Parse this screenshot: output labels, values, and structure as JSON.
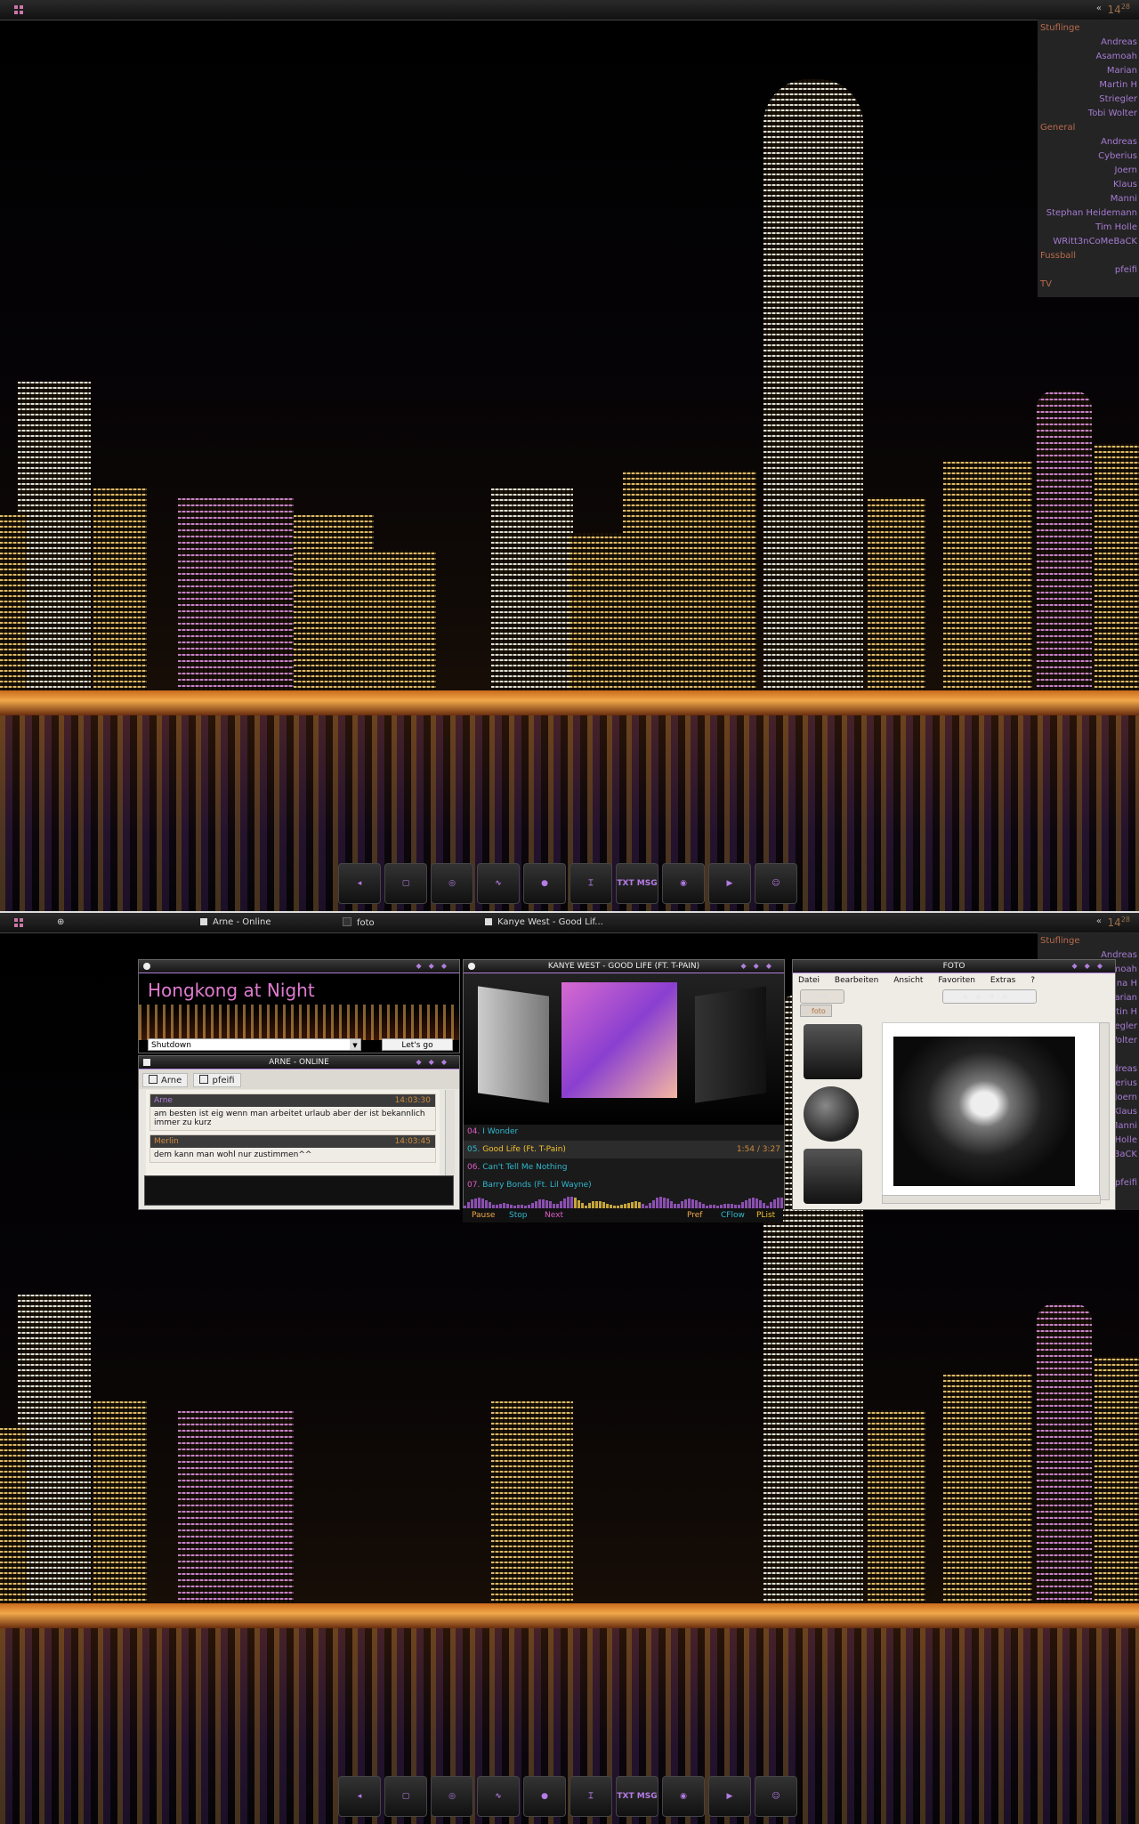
{
  "colors": {
    "accent_purple": "#a57bd3",
    "group_orange": "#b86a4c",
    "clock_orange": "#9a6e4b",
    "track_cyan": "#2fb8ce",
    "track_pink": "#e05cc8",
    "track_yellow": "#f1c02c"
  },
  "screen1": {
    "topbar": {
      "clock_hour": "14",
      "clock_min": "28",
      "tray_arrow": "«"
    },
    "contacts": [
      {
        "group": "Stuflinge",
        "items": [
          "Andreas",
          "Asamoah",
          "Marian",
          "Martin H",
          "Striegler",
          "Tobi Wolter"
        ]
      },
      {
        "group": "General",
        "items": [
          "Andreas",
          "Cyberius",
          "Joern",
          "Klaus",
          "Manni",
          "Stephan Heidemann",
          "Tim Holle",
          "WRitt3nCoMeBaCK"
        ]
      },
      {
        "group": "Fussball",
        "items": [
          "pfeifi"
        ]
      },
      {
        "group": "TV",
        "items": []
      }
    ]
  },
  "screen2": {
    "topbar": {
      "clock_hour": "14",
      "clock_min": "28",
      "tray_arrow": "«",
      "tasks": [
        "Arne - Online",
        "foto",
        "Kanye West - Good Lif..."
      ]
    },
    "contacts": [
      {
        "group": "Stuflinge",
        "items": [
          "Andreas",
          "Asamoah",
          "Christina H",
          "Marian",
          "Martin H",
          "Striegler",
          "Tobi Wolter"
        ]
      },
      {
        "group": "General",
        "items": [
          "Andreas",
          "Cyberius",
          "Joern",
          "Klaus",
          "Manni",
          "Tim Holle",
          "WRitt3nCoMeBaCK"
        ]
      },
      {
        "group": "Fussball",
        "items": [
          "pfeifi"
        ]
      },
      {
        "group": "TV",
        "items": []
      }
    ],
    "hk_widget": {
      "title": "Hongkong at Night",
      "select_value": "Shutdown",
      "button": "Let's go"
    },
    "chat": {
      "title": "ARNE - ONLINE",
      "tabs": [
        "Arne",
        "pfeifi"
      ],
      "messages": [
        {
          "name": "Arne",
          "time": "14:03:30",
          "text": "am besten ist eig wenn man arbeitet urlaub  aber der ist bekannlich immer zu kurz"
        },
        {
          "name": "Merlin",
          "time": "14:03:45",
          "text": "dem kann man wohl nur zustimmen^^"
        }
      ]
    },
    "player": {
      "title": "KANYE WEST - GOOD LIFE (FT. T-PAIN)",
      "tracks": [
        {
          "no": "04.",
          "title": "I Wonder",
          "time": ""
        },
        {
          "no": "05.",
          "title": "Good Life (Ft. T-Pain)",
          "time": "1:54 / 3:27"
        },
        {
          "no": "06.",
          "title": "Can't Tell Me Nothing",
          "time": ""
        },
        {
          "no": "07.",
          "title": "Barry Bonds (Ft. Lil Wayne)",
          "time": ""
        }
      ],
      "current_index": 1,
      "controls": [
        "Pause",
        "Stop",
        "Next",
        "Pref",
        "CFlow",
        "PList"
      ]
    },
    "foto": {
      "title": "FOTO",
      "menu": [
        "Datei",
        "Bearbeiten",
        "Ansicht",
        "Favoriten",
        "Extras",
        "?"
      ],
      "tab": "foto"
    }
  },
  "dock": {
    "items": [
      {
        "icon": "back-icon",
        "glyph": "◂"
      },
      {
        "icon": "window-icon",
        "glyph": "▢"
      },
      {
        "icon": "network-icon",
        "glyph": "◎"
      },
      {
        "icon": "activity-monitor-icon",
        "glyph": "∿"
      },
      {
        "icon": "apps-icon",
        "glyph": "●"
      },
      {
        "icon": "terminal-icon",
        "glyph": "⌶"
      },
      {
        "icon": "txt-msg-icon",
        "glyph": "TXT MSG"
      },
      {
        "icon": "settings-icon",
        "glyph": "◉"
      },
      {
        "icon": "video-icon",
        "glyph": "▶"
      },
      {
        "icon": "finder-icon",
        "glyph": "☺"
      }
    ]
  }
}
